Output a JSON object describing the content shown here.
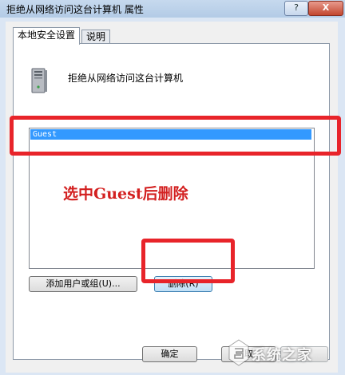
{
  "window": {
    "title": "拒绝从网络访问这台计算机 属性",
    "help_label": "?",
    "close_label": "X"
  },
  "tabs": [
    {
      "label": "本地安全设置",
      "active": true
    },
    {
      "label": "说明",
      "active": false
    }
  ],
  "policy": {
    "name": "拒绝从网络访问这台计算机",
    "icon": "computer-tower-icon"
  },
  "accounts": {
    "items": [
      {
        "label": "Guest",
        "selected": true
      }
    ]
  },
  "annotation": {
    "text": "选中Guest后删除",
    "color": "#d32020"
  },
  "buttons": {
    "add_label": "添加用户或组(U)...",
    "remove_label": "删除(R)",
    "ok_label": "确定",
    "cancel_label": "取",
    "apply_label": "应"
  },
  "highlight_color": "#e8242a",
  "watermark": {
    "text": "系统之家"
  }
}
